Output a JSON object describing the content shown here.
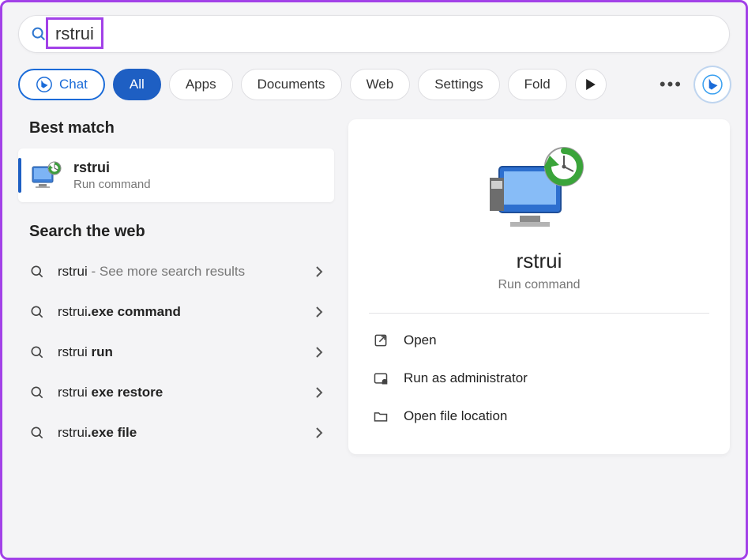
{
  "search": {
    "query": "rstrui"
  },
  "filters": {
    "chat": "Chat",
    "items": [
      "All",
      "Apps",
      "Documents",
      "Web",
      "Settings",
      "Fold"
    ],
    "active_index": 0
  },
  "left": {
    "best_match_heading": "Best match",
    "best_match": {
      "title": "rstrui",
      "subtitle": "Run command"
    },
    "web_heading": "Search the web",
    "web": [
      {
        "prefix": "rstrui",
        "bold": "",
        "hint": " - See more search results"
      },
      {
        "prefix": "rstrui",
        "bold": ".exe command",
        "hint": ""
      },
      {
        "prefix": "rstrui ",
        "bold": "run",
        "hint": ""
      },
      {
        "prefix": "rstrui ",
        "bold": "exe restore",
        "hint": ""
      },
      {
        "prefix": "rstrui",
        "bold": ".exe file",
        "hint": ""
      }
    ]
  },
  "right": {
    "title": "rstrui",
    "subtitle": "Run command",
    "actions": [
      {
        "icon": "open",
        "label": "Open"
      },
      {
        "icon": "admin",
        "label": "Run as administrator"
      },
      {
        "icon": "folder",
        "label": "Open file location"
      }
    ]
  }
}
